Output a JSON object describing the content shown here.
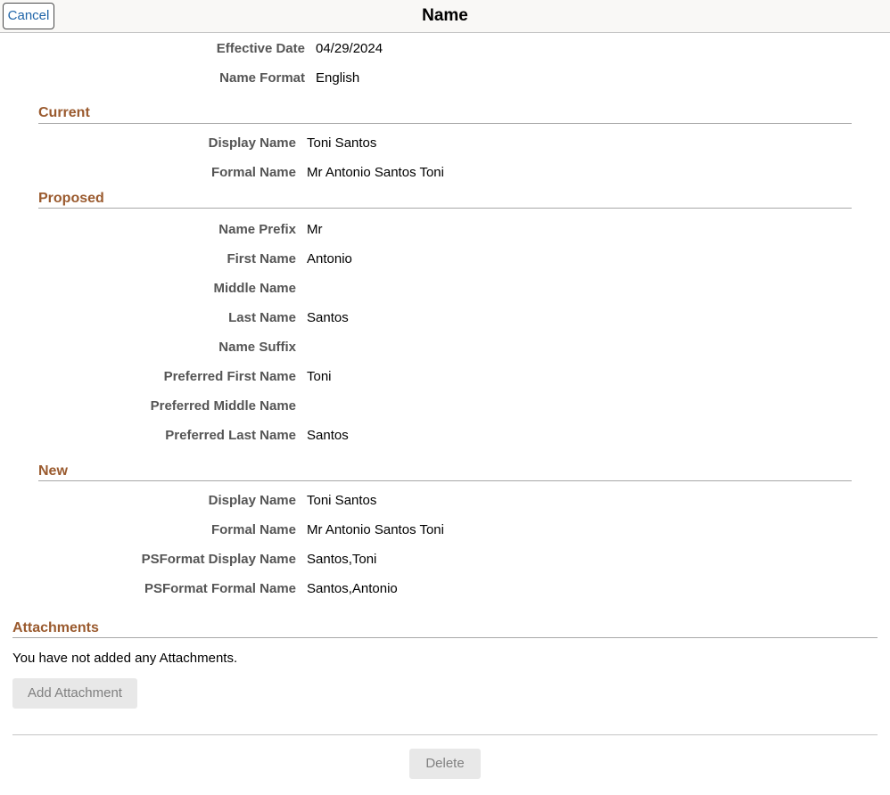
{
  "header": {
    "cancel_label": "Cancel",
    "title": "Name"
  },
  "top_fields": [
    {
      "label": "Effective Date",
      "value": "04/29/2024"
    },
    {
      "label": "Name Format",
      "value": "English"
    }
  ],
  "current": {
    "title": "Current",
    "fields": [
      {
        "label": "Display Name",
        "value": "Toni Santos"
      },
      {
        "label": "Formal Name",
        "value": "Mr Antonio Santos Toni"
      }
    ]
  },
  "proposed": {
    "title": "Proposed",
    "fields": [
      {
        "label": "Name Prefix",
        "value": "Mr"
      },
      {
        "label": "First Name",
        "value": "Antonio"
      },
      {
        "label": "Middle Name",
        "value": ""
      },
      {
        "label": "Last Name",
        "value": "Santos"
      },
      {
        "label": "Name Suffix",
        "value": ""
      },
      {
        "label": "Preferred First Name",
        "value": "Toni"
      },
      {
        "label": "Preferred Middle Name",
        "value": ""
      },
      {
        "label": "Preferred Last Name",
        "value": "Santos"
      }
    ]
  },
  "new": {
    "title": "New",
    "fields": [
      {
        "label": "Display Name",
        "value": "Toni Santos"
      },
      {
        "label": "Formal Name",
        "value": "Mr Antonio Santos Toni"
      },
      {
        "label": "PSFormat Display Name",
        "value": "Santos,Toni"
      },
      {
        "label": "PSFormat Formal Name",
        "value": "Santos,Antonio"
      }
    ]
  },
  "attachments": {
    "title": "Attachments",
    "empty_message": "You have not added any Attachments.",
    "add_label": "Add Attachment"
  },
  "footer": {
    "delete_label": "Delete"
  }
}
